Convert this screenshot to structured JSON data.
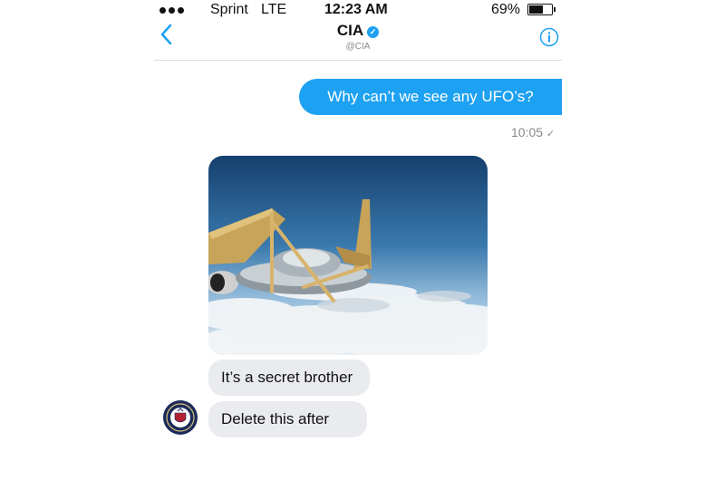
{
  "status_bar": {
    "carrier": "Sprint",
    "network": "LTE",
    "time": "12:23 AM",
    "battery_percent": "69%",
    "battery_level": 0.69
  },
  "header": {
    "title": "CIA",
    "handle": "@CIA",
    "verified_icon": "verified-badge-icon",
    "back_icon": "chevron-left-icon",
    "info_icon": "info-icon"
  },
  "messages": [
    {
      "direction": "outgoing",
      "text": "Why can’t we see any UFO’s?",
      "time": "10:05"
    },
    {
      "direction": "incoming",
      "type": "image",
      "image_description_icon": "photo-ufo-disguised-as-airplane"
    },
    {
      "direction": "incoming",
      "text": "It’s a secret brother"
    },
    {
      "direction": "incoming",
      "text": "Delete this after"
    }
  ],
  "colors": {
    "accent": "#1da1f2",
    "incoming_bubble": "#e9ebee",
    "muted_text": "#888888"
  }
}
